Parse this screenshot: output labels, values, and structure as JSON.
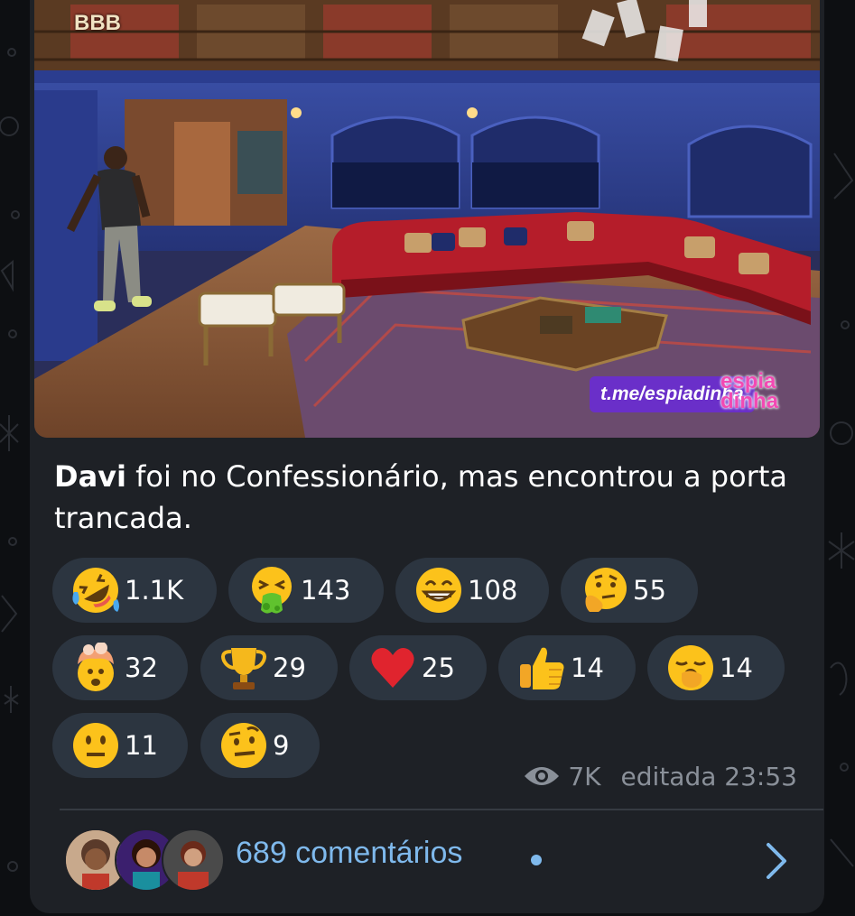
{
  "post": {
    "video_logo": "BBB",
    "watermark_link": "t.me/espiadinha",
    "watermark_brand": "espiadinha",
    "caption_name": "Davi",
    "caption_text": " foi no Confessionário, mas encontrou a porta trancada."
  },
  "reactions": [
    {
      "icon": "rofl-emoji-icon",
      "count": "1.1K"
    },
    {
      "icon": "vomiting-face-emoji-icon",
      "count": "143"
    },
    {
      "icon": "grinning-face-emoji-icon",
      "count": "108"
    },
    {
      "icon": "thinking-face-emoji-icon",
      "count": "55"
    },
    {
      "icon": "exploding-head-emoji-icon",
      "count": "32"
    },
    {
      "icon": "trophy-emoji-icon",
      "count": "29"
    },
    {
      "icon": "red-heart-emoji-icon",
      "count": "25"
    },
    {
      "icon": "thumbs-up-emoji-icon",
      "count": "14"
    },
    {
      "icon": "yawning-face-emoji-icon",
      "count": "14"
    },
    {
      "icon": "neutral-face-emoji-icon",
      "count": "11"
    },
    {
      "icon": "raised-eyebrow-face-emoji-icon",
      "count": "9"
    }
  ],
  "meta": {
    "views": "7K",
    "edited_time": "editada 23:53"
  },
  "comments": {
    "label": "689 comentários"
  },
  "colors": {
    "card_bg": "#1e2126",
    "chip_bg": "#2c3540",
    "link_blue": "#7fb9ec",
    "meta_gray": "#8a9099"
  }
}
